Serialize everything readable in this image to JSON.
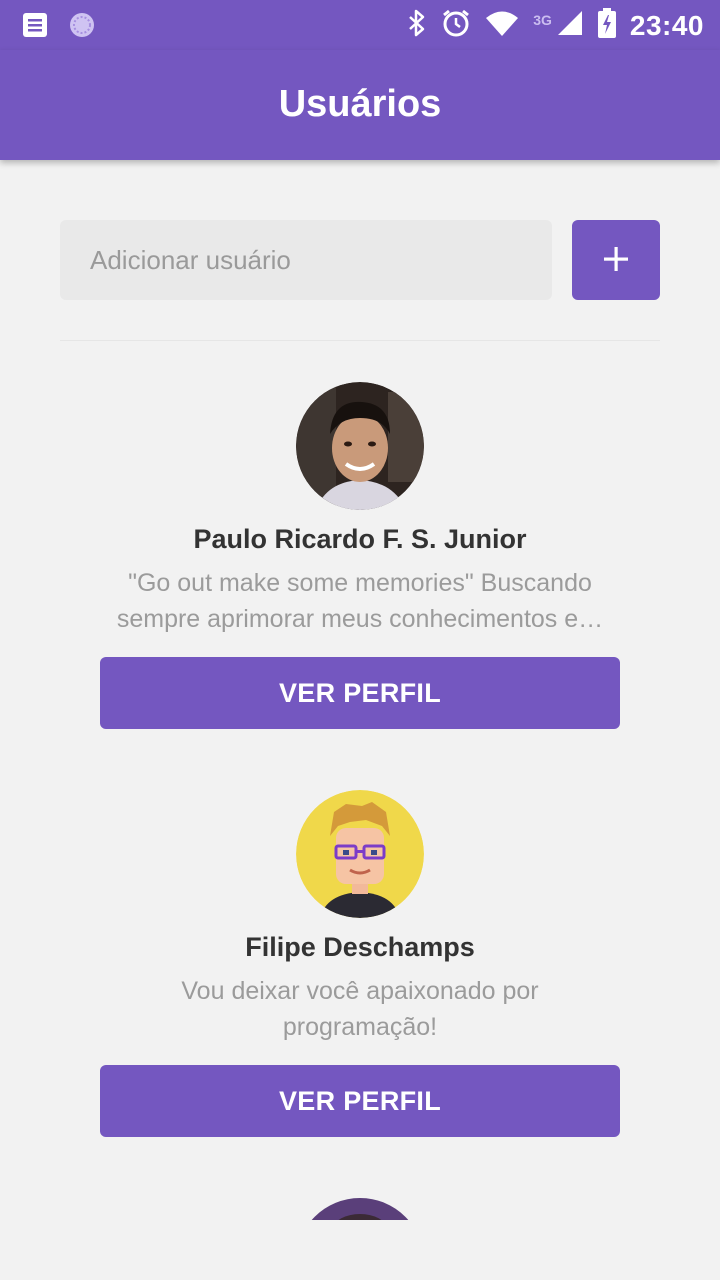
{
  "status_bar": {
    "time": "23:40",
    "network": "3G",
    "icons": [
      "notes-icon",
      "loading-circle-icon",
      "bluetooth-icon",
      "alarm-icon",
      "wifi-icon",
      "signal-icon",
      "battery-charging-icon"
    ]
  },
  "app_bar": {
    "title": "Usuários"
  },
  "add_user": {
    "placeholder": "Adicionar usuário",
    "button_icon": "plus-icon"
  },
  "users": [
    {
      "name": "Paulo Ricardo F. S. Junior",
      "bio": "\"Go out make some memories\"   Buscando sempre aprimorar meus conhecimentos e…",
      "button_label": "VER PERFIL",
      "avatar": "photo-avatar"
    },
    {
      "name": "Filipe Deschamps",
      "bio": "Vou deixar você apaixonado por programação!",
      "button_label": "VER PERFIL",
      "avatar": "pixel-art-avatar"
    }
  ],
  "colors": {
    "primary": "#7457c0",
    "background": "#f2f2f2",
    "muted_text": "#9b9b9b"
  }
}
